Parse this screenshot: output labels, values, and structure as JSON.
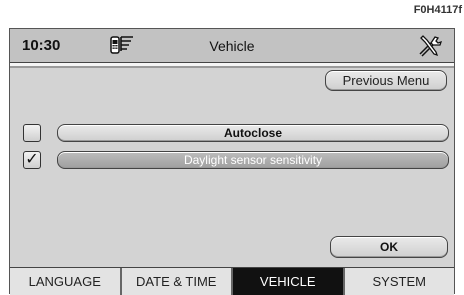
{
  "figure_ref": "F0H4117f",
  "header": {
    "time": "10:30",
    "title": "Vehicle",
    "phone_icon": "phone-signal-icon",
    "tools_icon": "tools-icon"
  },
  "buttons": {
    "previous_menu": "Previous Menu",
    "ok": "OK"
  },
  "options": [
    {
      "label": "Autoclose",
      "checked": false,
      "check_mark": ""
    },
    {
      "label": "Daylight sensor sensitivity",
      "checked": true,
      "check_mark": "✓"
    }
  ],
  "tabs": [
    {
      "label": "LANGUAGE",
      "active": false
    },
    {
      "label": "DATE & TIME",
      "active": false
    },
    {
      "label": "VEHICLE",
      "active": true
    },
    {
      "label": "SYSTEM",
      "active": false
    }
  ]
}
